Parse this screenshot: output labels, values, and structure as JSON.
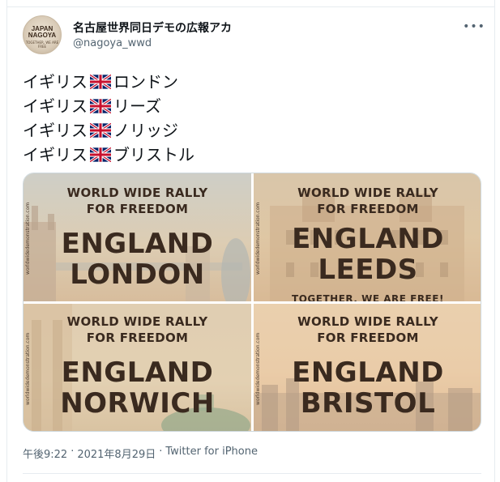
{
  "tweet": {
    "display_name": "名古屋世界同日デモの広報アカ",
    "handle": "@nagoya_wwd",
    "more_icon": "more-horizontal-icon",
    "avatar": {
      "line1": "JAPAN",
      "line2": "NAGOYA",
      "line3": "TOGETHER, WE ARE FREE"
    },
    "lines": [
      {
        "prefix": "イギリス",
        "city": "ロンドン"
      },
      {
        "prefix": "イギリス",
        "city": "リーズ"
      },
      {
        "prefix": "イギリス",
        "city": "ノリッジ"
      },
      {
        "prefix": "イギリス",
        "city": "ブリストル"
      }
    ],
    "flag_icon": "uk-flag-icon",
    "media": [
      {
        "rally1": "WORLD WIDE RALLY",
        "rally2": "FOR FREEDOM",
        "country": "ENGLAND",
        "city": "LONDON",
        "side": "worldwidedemonstration.com"
      },
      {
        "rally1": "WORLD WIDE RALLY",
        "rally2": "FOR FREEDOM",
        "country": "ENGLAND",
        "city": "LEEDS",
        "side": "worldwidedemonstration.com",
        "extra": "TOGETHER, WE ARE FREE!"
      },
      {
        "rally1": "WORLD WIDE RALLY",
        "rally2": "FOR FREEDOM",
        "country": "ENGLAND",
        "city": "NORWICH",
        "side": "worldwidedemonstration.com"
      },
      {
        "rally1": "WORLD WIDE RALLY",
        "rally2": "FOR FREEDOM",
        "country": "ENGLAND",
        "city": "BRISTOL",
        "side": "worldwidedemonstration.com"
      }
    ],
    "time": "午後9:22",
    "date": "2021年8月29日",
    "source": "Twitter for iPhone",
    "separator": "·"
  },
  "colors": {
    "text": "#0f1419",
    "secondary": "#536471",
    "border": "#e6ecf0",
    "poster_text": "#3a2a1f"
  }
}
